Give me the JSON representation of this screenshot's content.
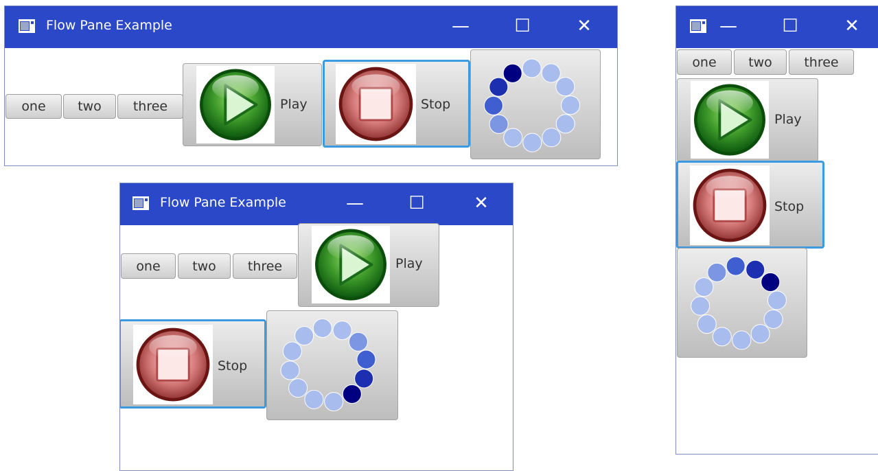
{
  "window": {
    "title": "Flow Pane Example",
    "controls": {
      "minimize": "—",
      "maximize": "☐",
      "close": "✕"
    }
  },
  "buttons": {
    "one": "one",
    "two": "two",
    "three": "three",
    "play": "Play",
    "stop": "Stop"
  },
  "icons": {
    "app": "window-app-icon",
    "play": "green-play-icon",
    "stop": "red-stop-icon",
    "loading": "loading-spinner-icon"
  },
  "colors": {
    "titlebar": "#2a48c8",
    "focus_ring": "#3b9be0",
    "spinner": [
      "#000080",
      "#1c2fb0",
      "#3f5fd0",
      "#7d96e3",
      "#a9bcee"
    ]
  }
}
